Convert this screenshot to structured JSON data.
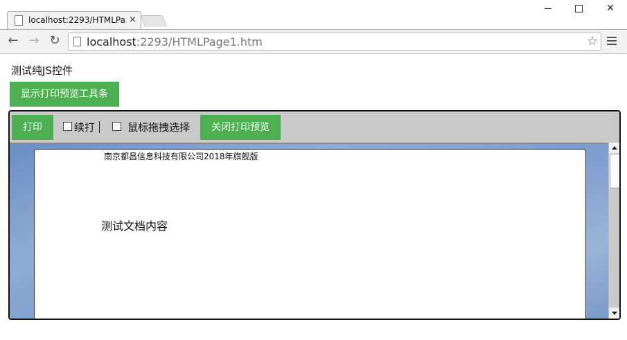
{
  "browser": {
    "tab_title": "localhost:2293/HTMLPa",
    "tab_close": "×",
    "url_host": "localhost",
    "url_rest": ":2293/HTMLPage1.htm",
    "star": "☆"
  },
  "page": {
    "heading": "测试纯JS控件",
    "show_toolbar_button": "显示打印预览工具条"
  },
  "viewer": {
    "print_button": "打印",
    "continue_print_label": "续打",
    "drag_select_label": "鼠标拖拽选择",
    "close_preview_button": "关闭打印预览",
    "company_text": "南京都昌信息科技有限公司2018年旗舰版",
    "document_content": "测试文档内容"
  }
}
